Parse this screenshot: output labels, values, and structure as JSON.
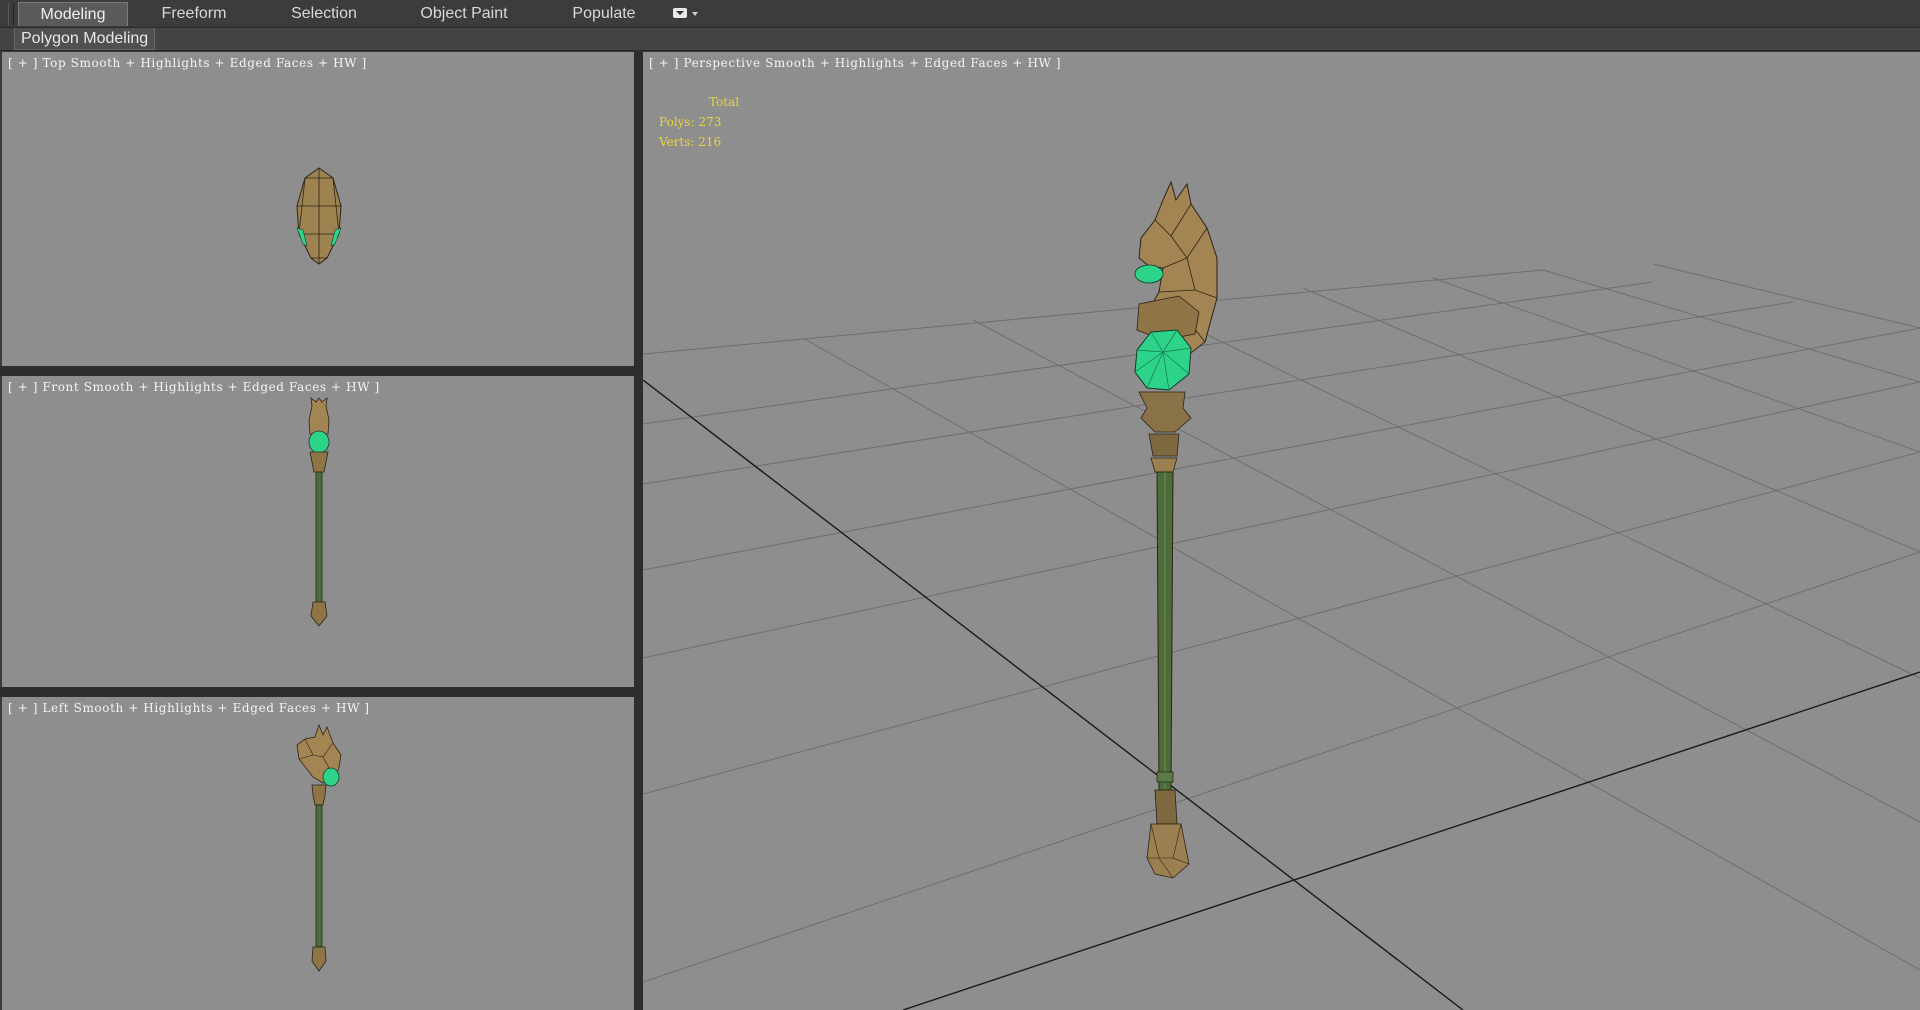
{
  "ribbon": {
    "tabs": [
      {
        "label": "Modeling"
      },
      {
        "label": "Freeform"
      },
      {
        "label": "Selection"
      },
      {
        "label": "Object Paint"
      },
      {
        "label": "Populate"
      }
    ],
    "active_tab": "Modeling"
  },
  "subribbon": {
    "label": "Polygon Modeling"
  },
  "viewports": {
    "top": {
      "plus": "[ + ]",
      "name": "Top",
      "shading": "Smooth + Highlights + Edged Faces + HW ]"
    },
    "front": {
      "plus": "[ + ]",
      "name": "Front",
      "shading": "Smooth + Highlights + Edged Faces + HW ]"
    },
    "left": {
      "plus": "[ + ]",
      "name": "Left",
      "shading": "Smooth + Highlights + Edged Faces + HW ]"
    },
    "perspective": {
      "plus": "[ + ]",
      "name": "Perspective",
      "shading": "Smooth + Highlights + Edged Faces + HW ]"
    }
  },
  "stats": {
    "header": "Total",
    "polys": "Polys: 273",
    "verts": "Verts: 216"
  },
  "colors": {
    "viewport_bg": "#8e8e8e",
    "stats_text": "#e8d53a",
    "gem": "#2ed38a",
    "bronze": "#a28552",
    "shaft": "#4f6b3a"
  }
}
